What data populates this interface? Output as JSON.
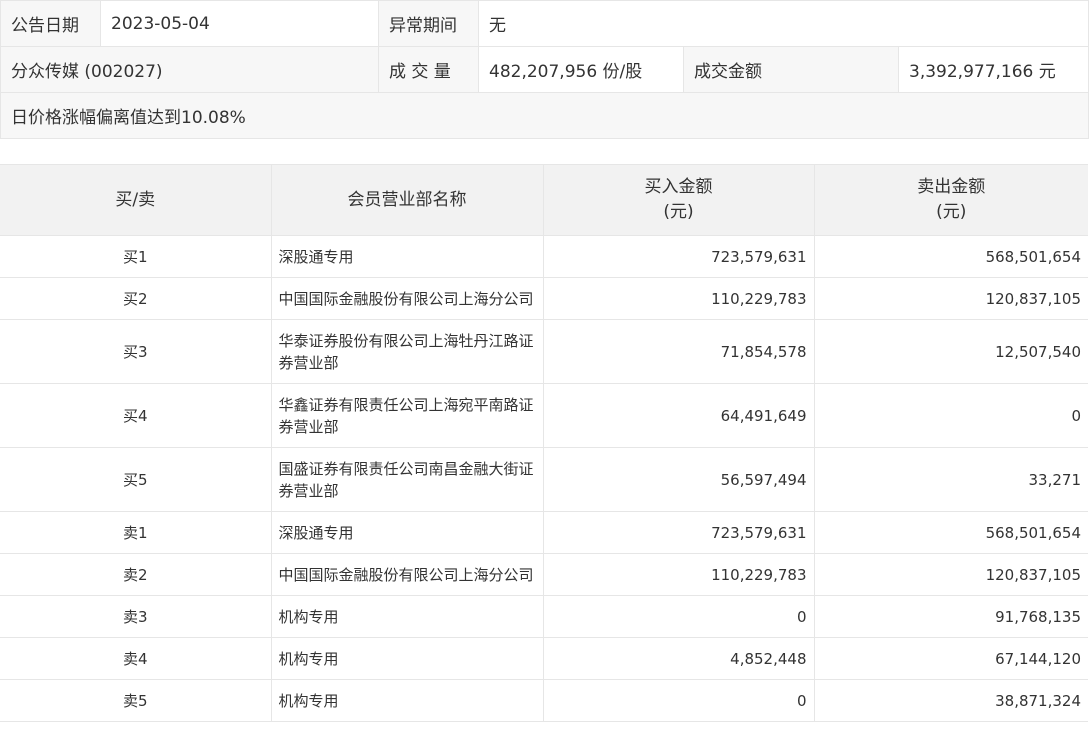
{
  "summary": {
    "date_label": "公告日期",
    "date_value": "2023-05-04",
    "period_label": "异常期间",
    "period_value": "无",
    "stock_name": "分众传媒 (002027)",
    "volume_label": "成 交 量",
    "volume_value": "482,207,956 份/股",
    "amount_label": "成交金额",
    "amount_value": "3,392,977,166 元",
    "reason": "日价格涨幅偏离值达到10.08%"
  },
  "table": {
    "headers": {
      "side": "买/卖",
      "broker": "会员营业部名称",
      "buy_amount": "买入金额",
      "buy_unit": "(元)",
      "sell_amount": "卖出金额",
      "sell_unit": "(元)"
    },
    "rows": [
      {
        "side": "买1",
        "broker": "深股通专用",
        "buy": "723,579,631",
        "sell": "568,501,654"
      },
      {
        "side": "买2",
        "broker": "中国国际金融股份有限公司上海分公司",
        "buy": "110,229,783",
        "sell": "120,837,105"
      },
      {
        "side": "买3",
        "broker": "华泰证券股份有限公司上海牡丹江路证券营业部",
        "buy": "71,854,578",
        "sell": "12,507,540"
      },
      {
        "side": "买4",
        "broker": "华鑫证券有限责任公司上海宛平南路证券营业部",
        "buy": "64,491,649",
        "sell": "0"
      },
      {
        "side": "买5",
        "broker": "国盛证券有限责任公司南昌金融大街证券营业部",
        "buy": "56,597,494",
        "sell": "33,271"
      },
      {
        "side": "卖1",
        "broker": "深股通专用",
        "buy": "723,579,631",
        "sell": "568,501,654"
      },
      {
        "side": "卖2",
        "broker": "中国国际金融股份有限公司上海分公司",
        "buy": "110,229,783",
        "sell": "120,837,105"
      },
      {
        "side": "卖3",
        "broker": "机构专用",
        "buy": "0",
        "sell": "91,768,135"
      },
      {
        "side": "卖4",
        "broker": "机构专用",
        "buy": "4,852,448",
        "sell": "67,144,120"
      },
      {
        "side": "卖5",
        "broker": "机构专用",
        "buy": "0",
        "sell": "38,871,324"
      }
    ]
  }
}
